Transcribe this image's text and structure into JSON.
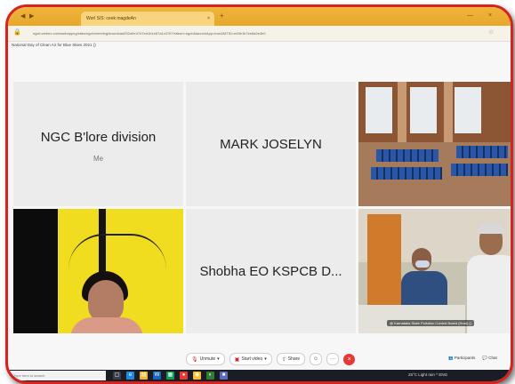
{
  "browser": {
    "tab_title": "Worl S/S: ceek magdeAn",
    "tab_close": "×",
    "new_tab": "+",
    "url": "ngcb.webex.com/webappng/sites/ngcb/meeting/download/f32a9e47d7ed1b1e87a1c37f0?siteurl=ngcb&launchApp=true&MTID=m5fe1b7ee8a2e4b0",
    "meeting_title": "National Day of Clean Air for Blue Skies 2021 ()",
    "window_controls": [
      "—",
      "×"
    ]
  },
  "participants": [
    {
      "name": "NGC B'lore division",
      "sub": "Me"
    },
    {
      "name": "MARK JOSELYN"
    },
    {
      "name": "Shobha EO KSPCB D..."
    },
    {
      "caption": "@ Karnataka State Pollution Control Board (Host) ()"
    }
  ],
  "toolbar": {
    "unmute": "Unmute",
    "start_video": "Start video",
    "share": "Share",
    "more": "···",
    "end": "×",
    "reactions": "☺",
    "participants": "Participants",
    "chat": "Chat"
  },
  "taskbar": {
    "search_placeholder": "Type here to search",
    "tray_text": "25°C Light rain   ^  ENG"
  },
  "colors": {
    "frame_border": "#d5241f",
    "end_button": "#e53935",
    "browser_tabstrip": "#e7a82a",
    "yellow_background": "#f1dd1f"
  }
}
